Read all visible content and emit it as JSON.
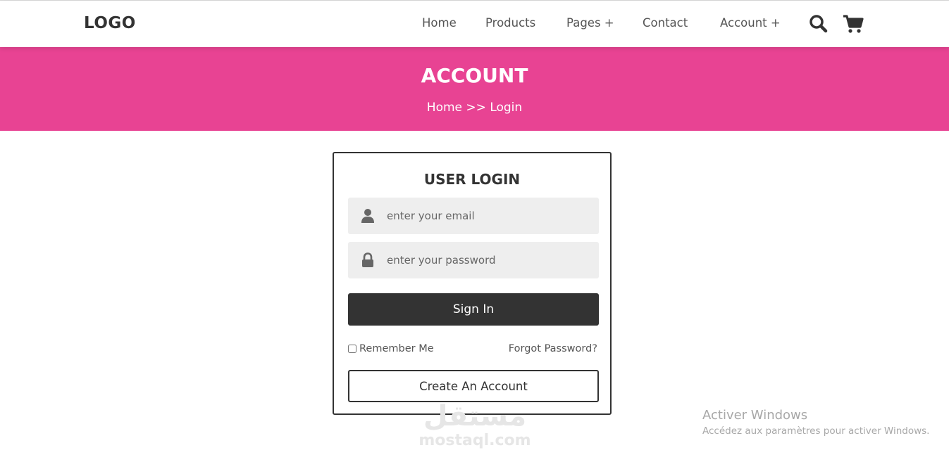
{
  "header": {
    "logo": "LOGO",
    "nav": [
      {
        "label": "Home"
      },
      {
        "label": "Products"
      },
      {
        "label": "Pages +"
      },
      {
        "label": "Contact"
      },
      {
        "label": "Account +"
      }
    ],
    "icons": [
      "search-icon",
      "cart-icon"
    ]
  },
  "banner": {
    "title": "ACCOUNT",
    "breadcrumb": {
      "home": "Home",
      "separator": ">>",
      "current": "Login"
    },
    "background": "#e84393"
  },
  "login": {
    "title": "USER LOGIN",
    "email": {
      "placeholder": "enter your email",
      "value": "",
      "icon": "user-icon"
    },
    "password": {
      "placeholder": "enter your password",
      "value": "",
      "icon": "lock-icon"
    },
    "signin_label": "Sign In",
    "remember_label": "Remember Me",
    "remember_checked": false,
    "forgot_label": "Forgot Password?",
    "create_label": "Create An Account"
  },
  "watermark": {
    "arabic": "مستقل",
    "site": "mostaql.com"
  },
  "activation": {
    "title": "Activer Windows",
    "subtitle": "Accédez aux paramètres pour activer Windows."
  }
}
